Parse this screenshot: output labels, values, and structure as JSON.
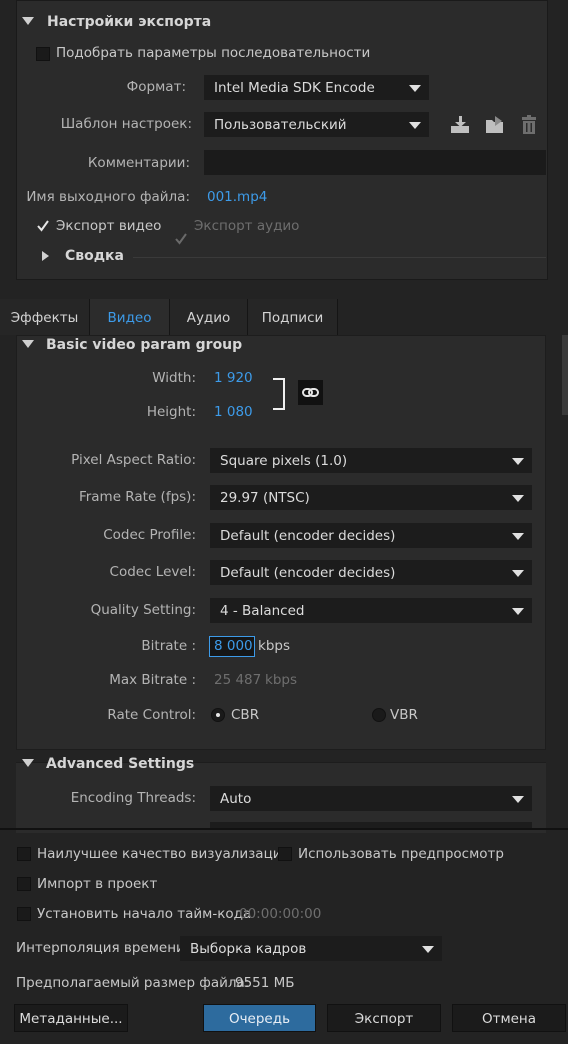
{
  "export_settings": {
    "title": "Настройки экспорта",
    "match_sequence_label": "Подобрать параметры последовательности",
    "format_label": "Формат:",
    "format_value": "Intel Media SDK Encode",
    "preset_label": "Шаблон настроек:",
    "preset_value": "Пользовательский",
    "comments_label": "Комментарии:",
    "comments_value": "",
    "output_name_label": "Имя выходного файла:",
    "output_name_value": "001.mp4",
    "export_video_label": "Экспорт видео",
    "export_audio_label": "Экспорт аудио",
    "summary_label": "Сводка"
  },
  "tabs": [
    "Эффекты",
    "Видео",
    "Аудио",
    "Подписи"
  ],
  "active_tab": "Видео",
  "basic_video": {
    "title": "Basic video param group",
    "width_label": "Width:",
    "width_value": "1 920",
    "height_label": "Height:",
    "height_value": "1 080",
    "pixel_aspect_label": "Pixel Aspect Ratio:",
    "pixel_aspect_value": "Square pixels (1.0)",
    "frame_rate_label": "Frame Rate (fps):",
    "frame_rate_value": "29.97 (NTSC)",
    "codec_profile_label": "Codec Profile:",
    "codec_profile_value": "Default (encoder decides)",
    "codec_level_label": "Codec Level:",
    "codec_level_value": "Default (encoder decides)",
    "quality_label": "Quality Setting:",
    "quality_value": "4 - Balanced",
    "bitrate_label": "Bitrate :",
    "bitrate_value": "8 000",
    "bitrate_unit": "kbps",
    "max_bitrate_label": "Max Bitrate :",
    "max_bitrate_value": "25 487",
    "max_bitrate_unit": "kbps",
    "rate_control_label": "Rate Control:",
    "rate_cbr": "CBR",
    "rate_vbr": "VBR"
  },
  "advanced": {
    "title": "Advanced Settings",
    "threads_label": "Encoding Threads:",
    "threads_value": "Auto"
  },
  "bottom": {
    "max_render_quality": "Наилучшее качество визуализации",
    "use_previews": "Использовать предпросмотр",
    "import_project": "Импорт в проект",
    "set_timecode": "Установить начало тайм-кода",
    "timecode_value": "00:00:00:00",
    "time_interp_label": "Интерполяция времени:",
    "time_interp_value": "Выборка кадров",
    "file_size_label": "Предполагаемый размер файла:",
    "file_size_value": "9551 МБ",
    "metadata_button": "Метаданные...",
    "queue_button": "Очередь",
    "export_button": "Экспорт",
    "cancel_button": "Отмена"
  },
  "colors": {
    "accent": "#3d9be9",
    "queue_button": "#2d6b9e",
    "background": "#232323"
  }
}
